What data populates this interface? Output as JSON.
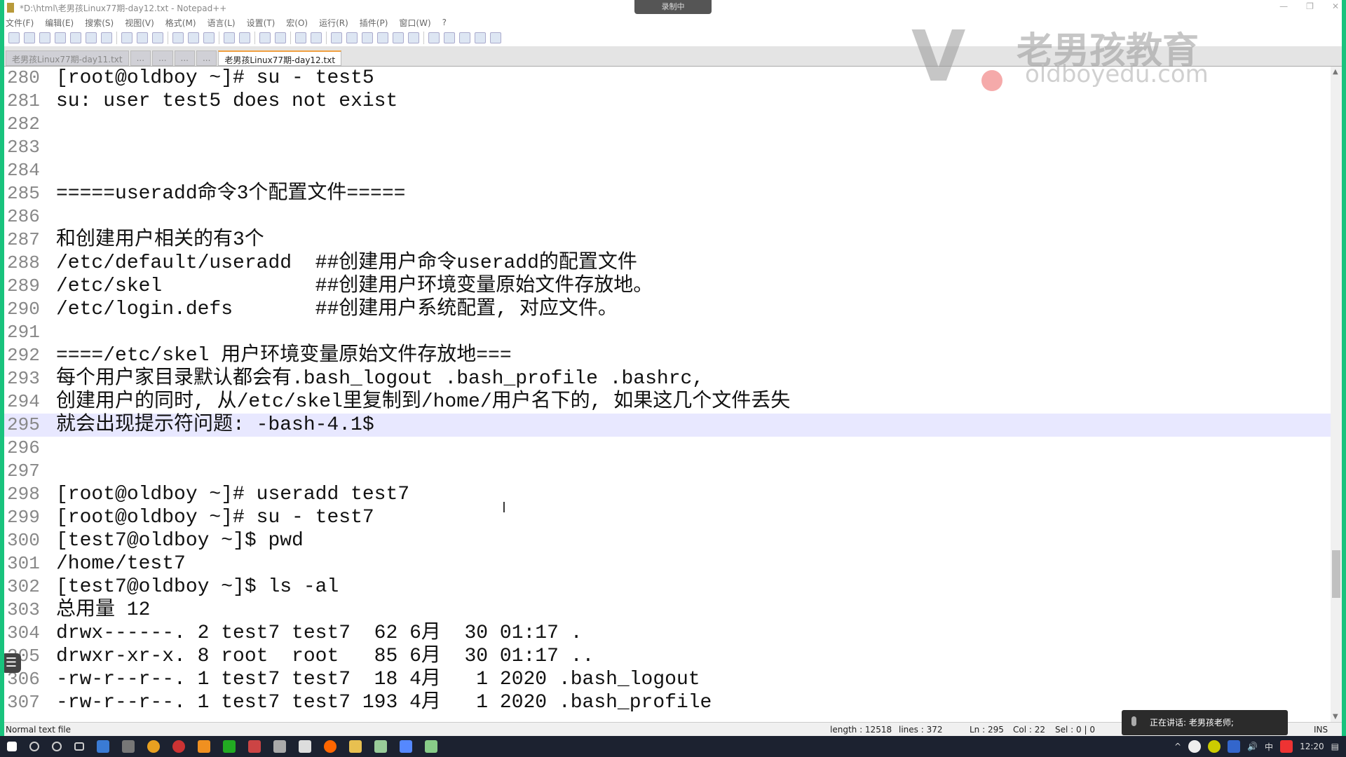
{
  "window": {
    "title": "*D:\\html\\老男孩Linux77期-day12.txt - Notepad++",
    "recording_label": "录制中",
    "controls": [
      "—",
      "❐",
      "✕"
    ]
  },
  "menu": [
    "文件(F)",
    "编辑(E)",
    "搜索(S)",
    "视图(V)",
    "格式(M)",
    "语言(L)",
    "设置(T)",
    "宏(O)",
    "运行(R)",
    "插件(P)",
    "窗口(W)",
    "?"
  ],
  "tabs": [
    {
      "label": "老男孩Linux77期-day11.txt",
      "active": false
    },
    {
      "label": "...",
      "active": false
    },
    {
      "label": "...",
      "active": false
    },
    {
      "label": "...",
      "active": false
    },
    {
      "label": "...",
      "active": false
    },
    {
      "label": "老男孩Linux77期-day12.txt",
      "active": true
    }
  ],
  "watermark": {
    "brand_cn": "老男孩教育",
    "brand_en": "oldboyedu.com"
  },
  "editor": {
    "current_line": 295,
    "lines": [
      {
        "n": "280",
        "t": "[root@oldboy ~]# su - test5"
      },
      {
        "n": "281",
        "t": "su: user test5 does not exist"
      },
      {
        "n": "282",
        "t": ""
      },
      {
        "n": "283",
        "t": ""
      },
      {
        "n": "284",
        "t": ""
      },
      {
        "n": "285",
        "t": "=====useradd命令3个配置文件====="
      },
      {
        "n": "286",
        "t": ""
      },
      {
        "n": "287",
        "t": "和创建用户相关的有3个"
      },
      {
        "n": "288",
        "t": "/etc/default/useradd  ##创建用户命令useradd的配置文件"
      },
      {
        "n": "289",
        "t": "/etc/skel             ##创建用户环境变量原始文件存放地。"
      },
      {
        "n": "290",
        "t": "/etc/login.defs       ##创建用户系统配置, 对应文件。"
      },
      {
        "n": "291",
        "t": ""
      },
      {
        "n": "292",
        "t": "====/etc/skel 用户环境变量原始文件存放地==="
      },
      {
        "n": "293",
        "t": "每个用户家目录默认都会有.bash_logout .bash_profile .bashrc,"
      },
      {
        "n": "294",
        "t": "创建用户的同时, 从/etc/skel里复制到/home/用户名下的, 如果这几个文件丢失"
      },
      {
        "n": "295",
        "t": "就会出现提示符问题: -bash-4.1$"
      },
      {
        "n": "296",
        "t": ""
      },
      {
        "n": "297",
        "t": ""
      },
      {
        "n": "298",
        "t": "[root@oldboy ~]# useradd test7"
      },
      {
        "n": "299",
        "t": "[root@oldboy ~]# su - test7"
      },
      {
        "n": "300",
        "t": "[test7@oldboy ~]$ pwd"
      },
      {
        "n": "301",
        "t": "/home/test7"
      },
      {
        "n": "302",
        "t": "[test7@oldboy ~]$ ls -al"
      },
      {
        "n": "303",
        "t": "总用量 12"
      },
      {
        "n": "304",
        "t": "drwx------. 2 test7 test7  62 6月  30 01:17 ."
      },
      {
        "n": "305",
        "t": "drwxr-xr-x. 8 root  root   85 6月  30 01:17 .."
      },
      {
        "n": "306",
        "t": "-rw-r--r--. 1 test7 test7  18 4月   1 2020 .bash_logout"
      },
      {
        "n": "307",
        "t": "-rw-r--r--. 1 test7 test7 193 4月   1 2020 .bash_profile"
      }
    ]
  },
  "statusbar": {
    "file_type": "Normal text file",
    "length": "length : 12518",
    "lines": "lines : 372",
    "ln": "Ln : 295",
    "col": "Col : 22",
    "sel": "Sel : 0 | 0",
    "mode": "INS"
  },
  "notification": {
    "text": "正在讲话: 老男孩老师;"
  },
  "taskbar": {
    "clock": "12:20",
    "ime": "中"
  }
}
